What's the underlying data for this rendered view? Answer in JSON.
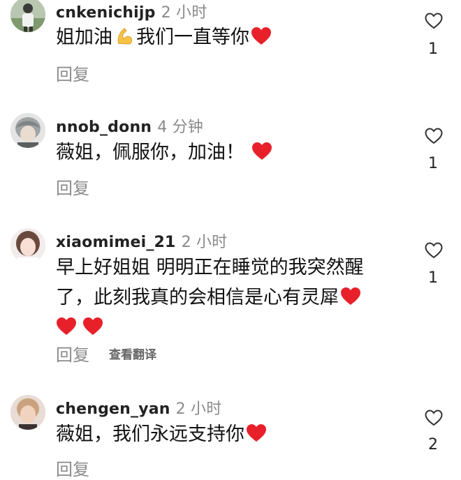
{
  "comments": [
    {
      "username": "cnkenichijp",
      "time": "2 小时",
      "text_parts": [
        "姐加油",
        "我们一直等你"
      ],
      "reply": "回复",
      "likes": "1",
      "avatar": "avatar-photo-man-outdoors"
    },
    {
      "username": "nnob_donn",
      "time": "4 分钟",
      "text": "薇姐，佩服你，加油！",
      "reply": "回复",
      "likes": "1",
      "avatar": "avatar-gray-hair"
    },
    {
      "username": "xiaomimei_21",
      "time": "2 小时",
      "line1": "早上好姐姐 明明正在睡觉的我突然醒",
      "line2": "了，此刻我真的会相信是心有灵犀",
      "reply": "回复",
      "translate": "查看翻译",
      "likes": "1",
      "avatar": "avatar-girl-photo"
    },
    {
      "username": "chengen_yan",
      "time": "2 小时",
      "text": "薇姐，我们永远支持你",
      "reply": "回复",
      "likes": "2",
      "avatar": "avatar-person-photo"
    }
  ],
  "colors": {
    "heart_red": "#e8202a",
    "meta_gray": "#8a8a8a",
    "like_outline": "#333333"
  },
  "icons": [
    "heart-outline-icon",
    "red-heart-emoji",
    "flexed-biceps-emoji"
  ]
}
